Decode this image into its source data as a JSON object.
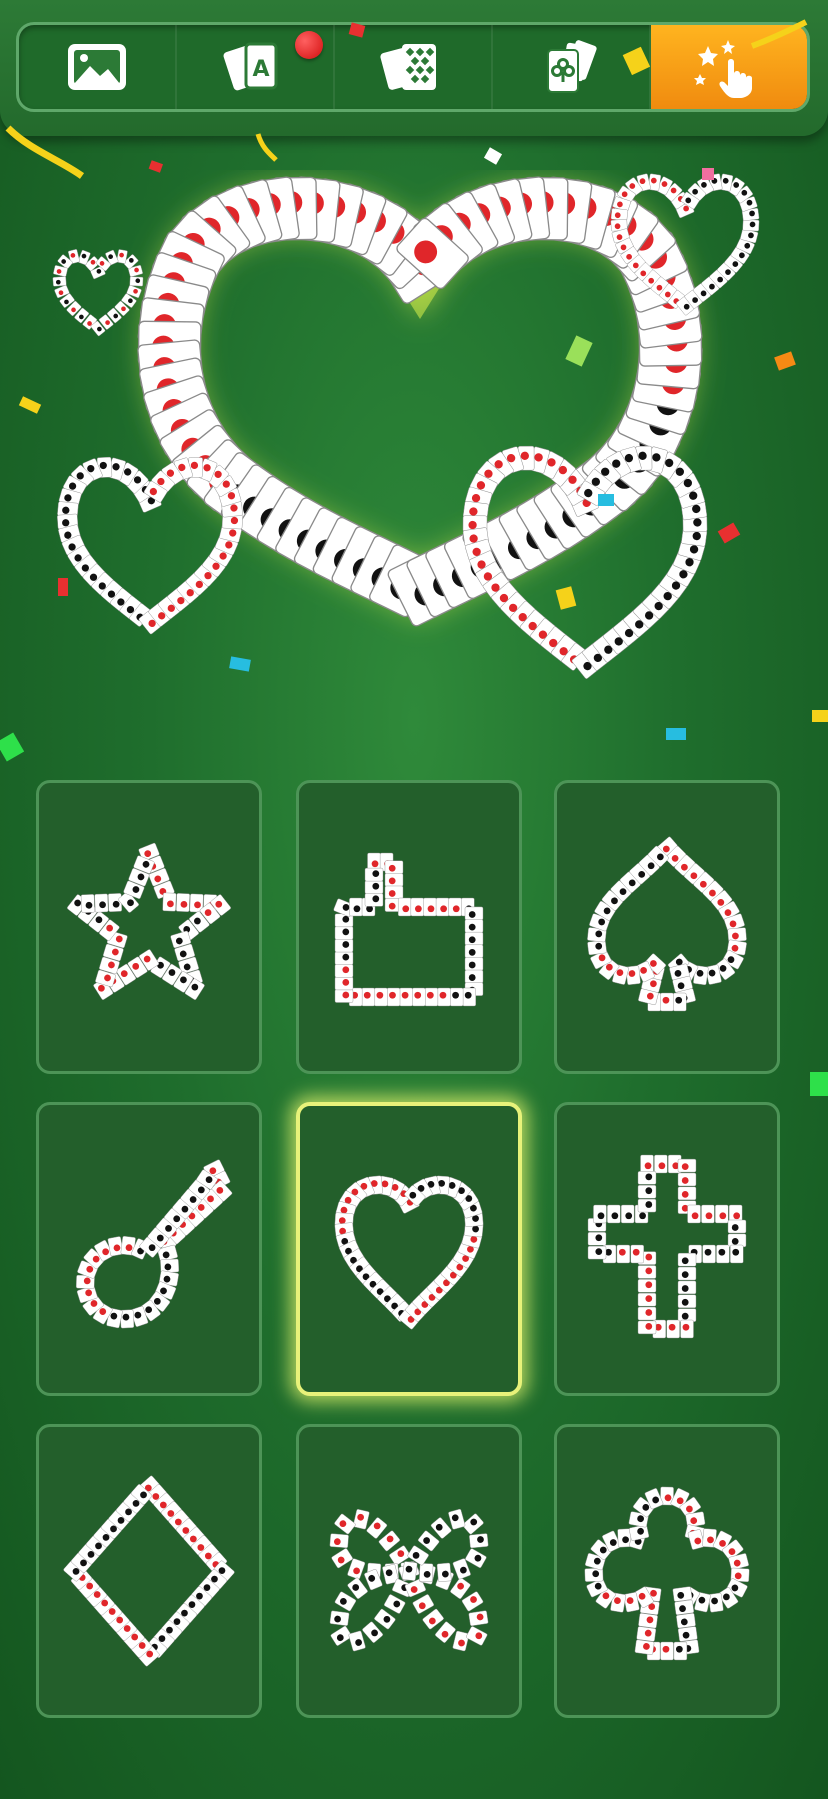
{
  "tabs": [
    {
      "name": "gallery",
      "icon": "image-icon"
    },
    {
      "name": "single-card",
      "icon": "ace-cards-icon",
      "notification": true
    },
    {
      "name": "card-backs",
      "icon": "card-back-icon"
    },
    {
      "name": "card-faces",
      "icon": "club-cards-icon"
    },
    {
      "name": "effects",
      "icon": "magic-tap-icon",
      "active": true
    }
  ],
  "colors": {
    "felt": "#1f6e2d",
    "active_tab": "#f5a015",
    "glow": "#e8f27a",
    "card_red": "#e0262a",
    "card_black": "#111111"
  },
  "tiles": [
    {
      "shape": "star"
    },
    {
      "shape": "thumbs-up"
    },
    {
      "shape": "spade"
    },
    {
      "shape": "guitar"
    },
    {
      "shape": "heart",
      "selected": true
    },
    {
      "shape": "cross"
    },
    {
      "shape": "diamond"
    },
    {
      "shape": "butterfly"
    },
    {
      "shape": "club"
    }
  ]
}
